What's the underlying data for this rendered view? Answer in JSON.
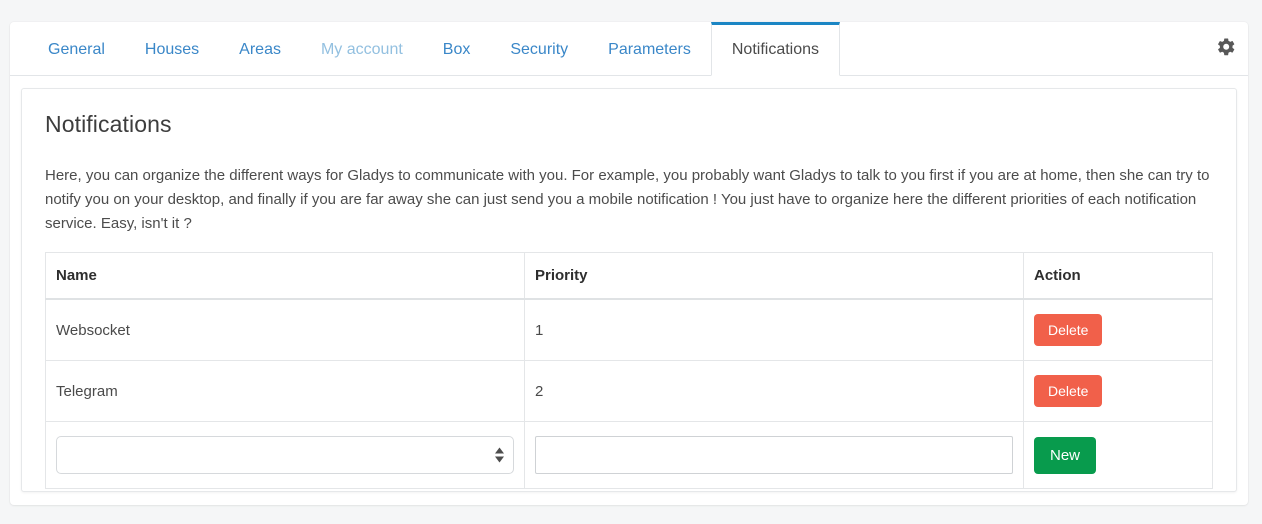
{
  "tabs": [
    {
      "label": "General",
      "state": "link"
    },
    {
      "label": "Houses",
      "state": "link"
    },
    {
      "label": "Areas",
      "state": "link"
    },
    {
      "label": "My account",
      "state": "muted"
    },
    {
      "label": "Box",
      "state": "link"
    },
    {
      "label": "Security",
      "state": "link"
    },
    {
      "label": "Parameters",
      "state": "link"
    },
    {
      "label": "Notifications",
      "state": "active"
    }
  ],
  "toolbar": {
    "settings_icon": "gear-icon"
  },
  "page": {
    "title": "Notifications",
    "intro": "Here, you can organize the different ways for Gladys to communicate with you. For example, you probably want Gladys to talk to you first if you are at home, then she can try to notify you on your desktop, and finally if you are far away she can just send you a mobile notification ! You just have to organize here the different priorities of each notification service. Easy, isn't it ?"
  },
  "table": {
    "columns": [
      "Name",
      "Priority",
      "Action"
    ],
    "rows": [
      {
        "name": "Websocket",
        "priority": "1",
        "action_label": "Delete"
      },
      {
        "name": "Telegram",
        "priority": "2",
        "action_label": "Delete"
      }
    ],
    "new_row": {
      "service_value": "",
      "service_placeholder": "",
      "priority_value": "",
      "priority_placeholder": "",
      "submit_label": "New"
    }
  },
  "colors": {
    "accent_blue": "#1b86c4",
    "link_blue": "#3a87c8",
    "muted_blue": "#93c0e0",
    "delete_red": "#f1604a",
    "new_green": "#089b4d",
    "page_bg": "#f5f6f7"
  }
}
